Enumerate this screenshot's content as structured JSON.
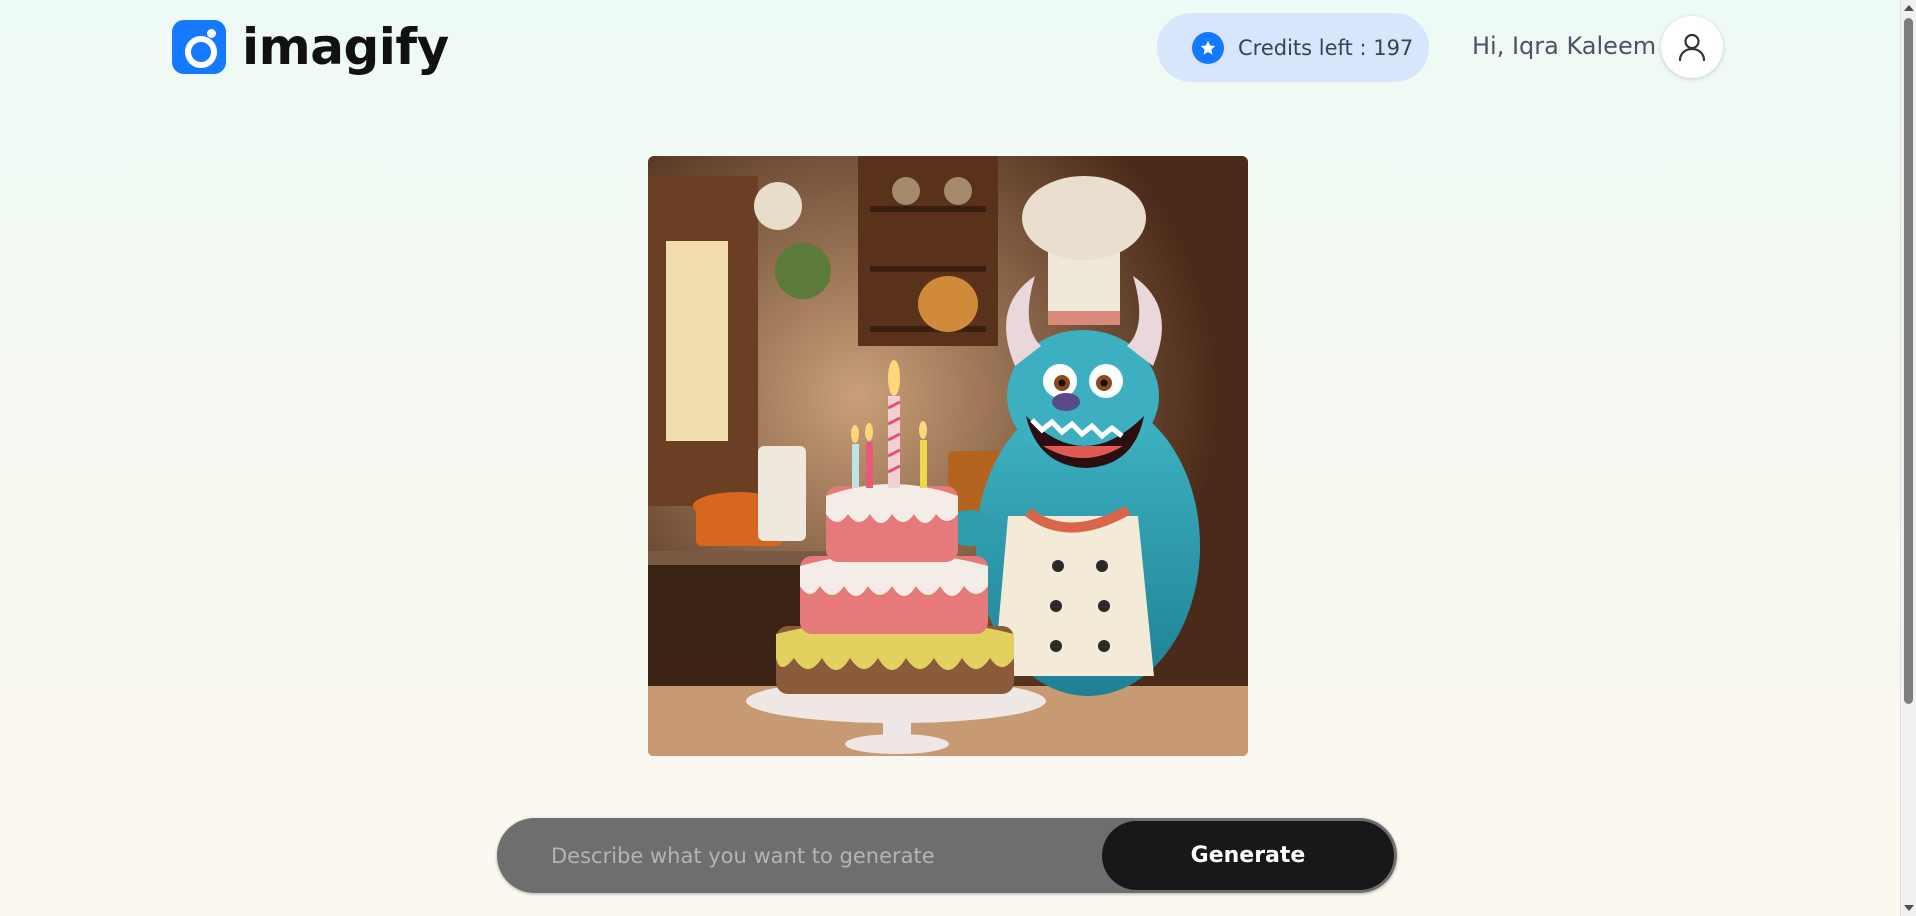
{
  "header": {
    "logo_text": "imagify",
    "credits_label": "Credits left : 197",
    "greeting": "Hi, Iqra Kaleem"
  },
  "result": {
    "image_subject": "blue furry monster chef with birthday cake in kitchen"
  },
  "prompt": {
    "placeholder": "Describe what you want to generate",
    "value": "",
    "generate_label": "Generate"
  },
  "colors": {
    "brand": "#1479ff",
    "credits_bg": "#d8e6fb",
    "prompt_bg": "#6e6e6e",
    "button_bg": "#18181a"
  },
  "icons": {
    "logo": "camera-lens-icon",
    "credits": "star-badge-icon",
    "avatar": "user-icon"
  }
}
